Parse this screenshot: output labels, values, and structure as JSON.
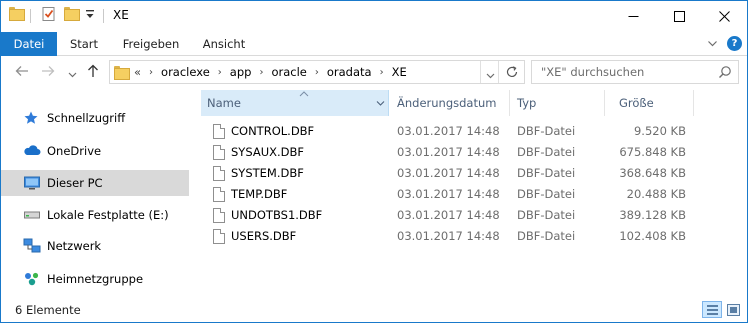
{
  "window": {
    "title": "XE",
    "controls": {
      "minimize": "—",
      "maximize": "☐",
      "close": "✕"
    }
  },
  "ribbon": {
    "tabs": [
      {
        "label": "Datei",
        "active": true
      },
      {
        "label": "Start"
      },
      {
        "label": "Freigeben"
      },
      {
        "label": "Ansicht"
      }
    ],
    "expand_icon": "chevron-down",
    "help_icon": "?"
  },
  "address": {
    "overflow": "«",
    "breadcrumbs": [
      "oraclexe",
      "app",
      "oracle",
      "oradata",
      "XE"
    ],
    "separator": "›"
  },
  "search": {
    "placeholder": "\"XE\" durchsuchen"
  },
  "nav_pane": {
    "items": [
      {
        "label": "Schnellzugriff",
        "icon": "star-icon"
      },
      {
        "label": "OneDrive",
        "icon": "cloud-icon"
      },
      {
        "label": "Dieser PC",
        "icon": "computer-icon",
        "selected": true
      },
      {
        "label": "Lokale Festplatte (E:)",
        "icon": "drive-icon"
      },
      {
        "label": "Netzwerk",
        "icon": "network-icon"
      },
      {
        "label": "Heimnetzgruppe",
        "icon": "homegroup-icon"
      }
    ]
  },
  "file_list": {
    "columns": [
      "Name",
      "Änderungsdatum",
      "Typ",
      "Größe"
    ],
    "rows": [
      {
        "name": "CONTROL.DBF",
        "date": "03.01.2017 14:48",
        "type": "DBF-Datei",
        "size": "9.520 KB"
      },
      {
        "name": "SYSAUX.DBF",
        "date": "03.01.2017 14:48",
        "type": "DBF-Datei",
        "size": "675.848 KB"
      },
      {
        "name": "SYSTEM.DBF",
        "date": "03.01.2017 14:48",
        "type": "DBF-Datei",
        "size": "368.648 KB"
      },
      {
        "name": "TEMP.DBF",
        "date": "03.01.2017 14:48",
        "type": "DBF-Datei",
        "size": "20.488 KB"
      },
      {
        "name": "UNDOTBS1.DBF",
        "date": "03.01.2017 14:48",
        "type": "DBF-Datei",
        "size": "389.128 KB"
      },
      {
        "name": "USERS.DBF",
        "date": "03.01.2017 14:48",
        "type": "DBF-Datei",
        "size": "102.408 KB"
      }
    ]
  },
  "status": {
    "text": "6 Elemente"
  },
  "colors": {
    "accent": "#1979ca",
    "selected_nav": "#d9d9d9",
    "header_hover": "#d9ebf9"
  }
}
